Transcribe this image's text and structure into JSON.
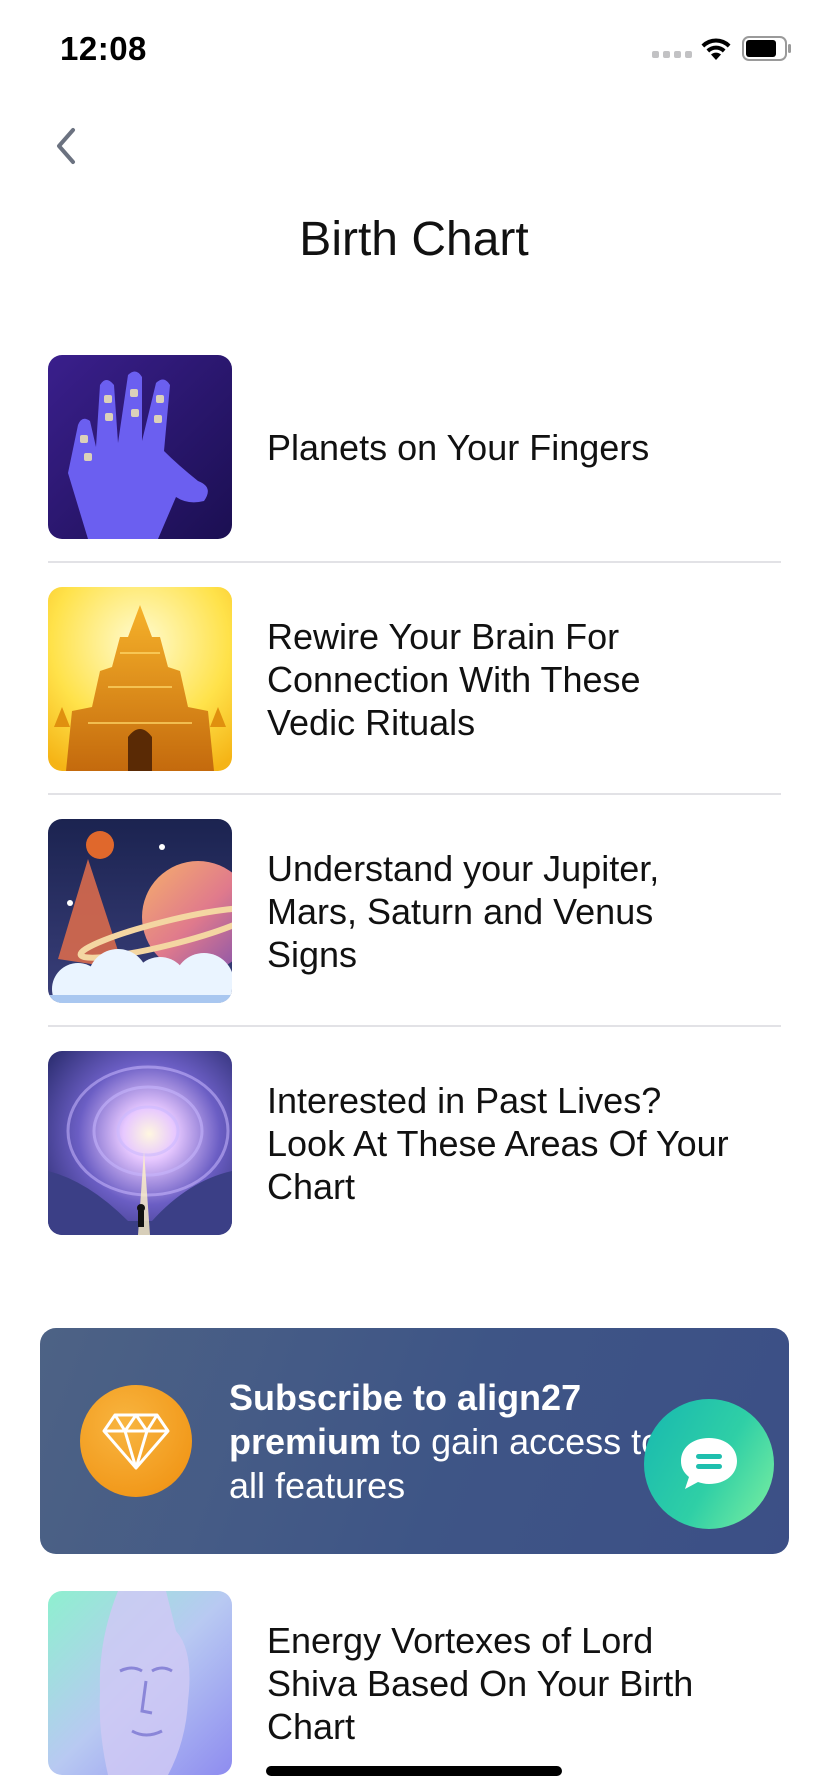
{
  "status_bar": {
    "time": "12:08"
  },
  "header": {
    "title": "Birth Chart"
  },
  "articles": [
    {
      "title": "Planets on Your Fingers",
      "image": "palm-planets"
    },
    {
      "title": "Rewire Your Brain For Connection With These Vedic Rituals",
      "image": "golden-temple"
    },
    {
      "title": "Understand your Jupiter, Mars, Saturn and Venus Signs",
      "image": "planets-clouds"
    },
    {
      "title": "Interested in Past Lives? Look At These Areas Of Your Chart",
      "image": "cosmic-vortex"
    }
  ],
  "premium_banner": {
    "bold_text": "Subscribe to align27 premium",
    "rest_text": " to gain access to all features",
    "icon": "diamond-icon"
  },
  "last_article": {
    "title": "Energy Vortexes of Lord Shiva Based On Your Birth Chart",
    "image": "shiva-statue"
  },
  "colors": {
    "banner": "#3e5586",
    "gem_badge": "#f29a1c",
    "chat_fab_start": "#17b8b0",
    "chat_fab_end": "#7ef0a0"
  }
}
